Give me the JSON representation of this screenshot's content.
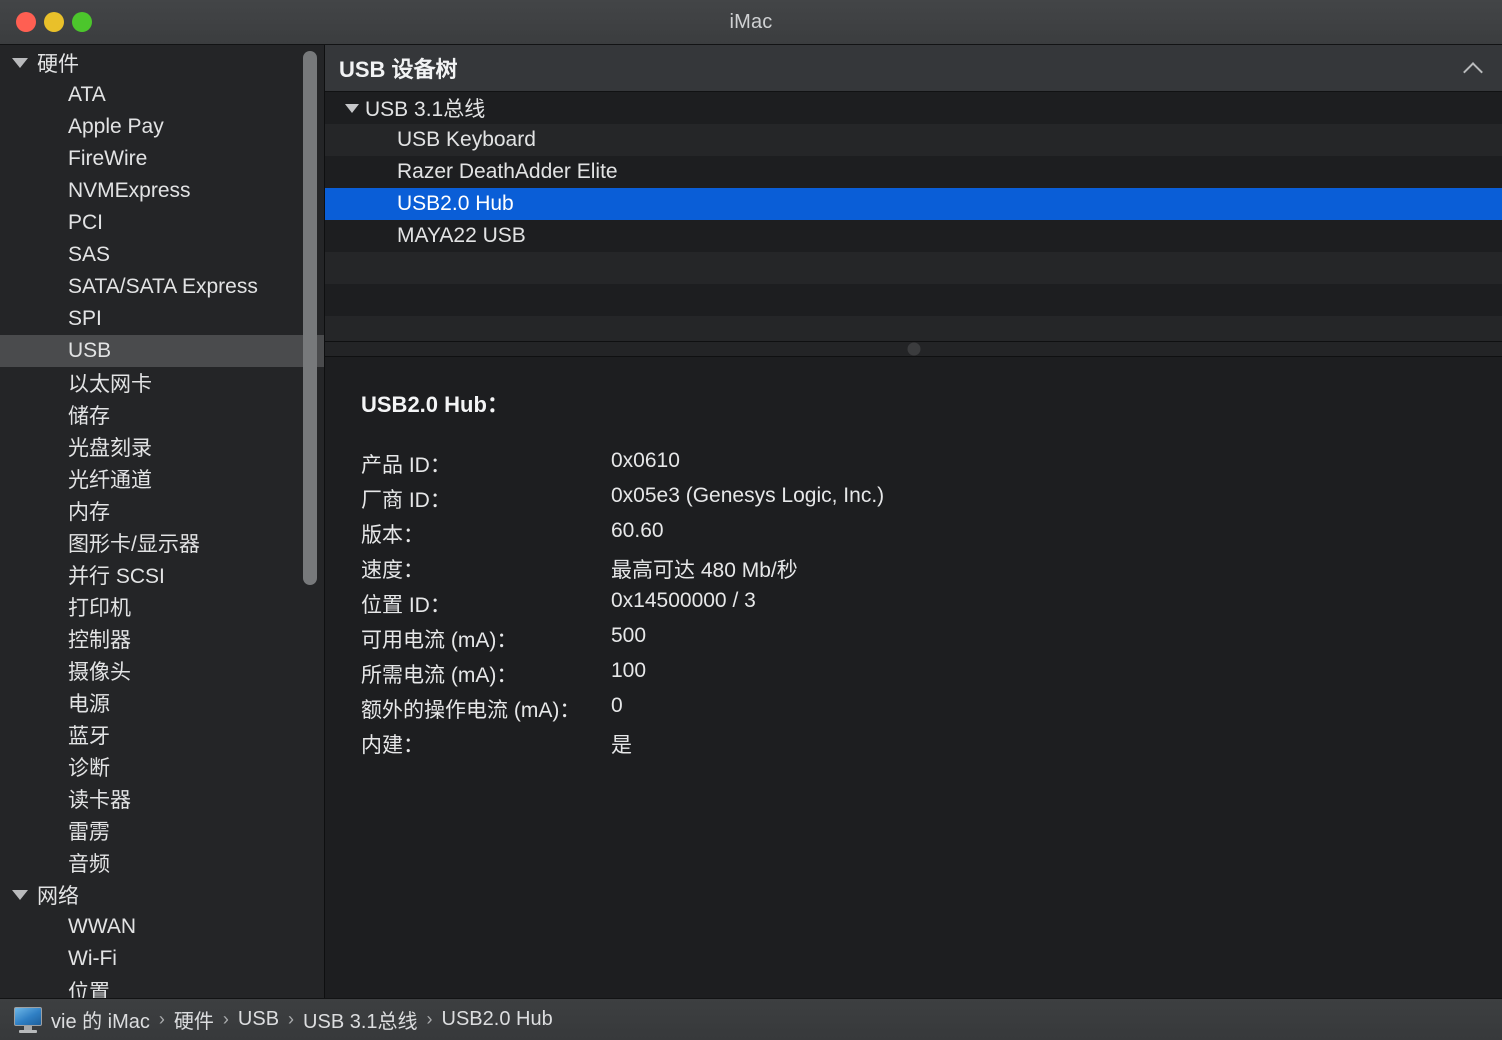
{
  "window": {
    "title": "iMac",
    "traffic_lights": [
      {
        "name": "close",
        "color": "#ff5f52"
      },
      {
        "name": "minimize",
        "color": "#e9c02a"
      },
      {
        "name": "zoom",
        "color": "#4cc62c"
      }
    ]
  },
  "sidebar": {
    "items": [
      {
        "label": "硬件",
        "type": "group",
        "expanded": true,
        "selected": false
      },
      {
        "label": "ATA",
        "type": "child",
        "selected": false
      },
      {
        "label": "Apple Pay",
        "type": "child",
        "selected": false
      },
      {
        "label": "FireWire",
        "type": "child",
        "selected": false
      },
      {
        "label": "NVMExpress",
        "type": "child",
        "selected": false
      },
      {
        "label": "PCI",
        "type": "child",
        "selected": false
      },
      {
        "label": "SAS",
        "type": "child",
        "selected": false
      },
      {
        "label": "SATA/SATA Express",
        "type": "child",
        "selected": false
      },
      {
        "label": "SPI",
        "type": "child",
        "selected": false
      },
      {
        "label": "USB",
        "type": "child",
        "selected": true
      },
      {
        "label": "以太网卡",
        "type": "child",
        "selected": false
      },
      {
        "label": "储存",
        "type": "child",
        "selected": false
      },
      {
        "label": "光盘刻录",
        "type": "child",
        "selected": false
      },
      {
        "label": "光纤通道",
        "type": "child",
        "selected": false
      },
      {
        "label": "内存",
        "type": "child",
        "selected": false
      },
      {
        "label": "图形卡/显示器",
        "type": "child",
        "selected": false
      },
      {
        "label": "并行 SCSI",
        "type": "child",
        "selected": false
      },
      {
        "label": "打印机",
        "type": "child",
        "selected": false
      },
      {
        "label": "控制器",
        "type": "child",
        "selected": false
      },
      {
        "label": "摄像头",
        "type": "child",
        "selected": false
      },
      {
        "label": "电源",
        "type": "child",
        "selected": false
      },
      {
        "label": "蓝牙",
        "type": "child",
        "selected": false
      },
      {
        "label": "诊断",
        "type": "child",
        "selected": false
      },
      {
        "label": "读卡器",
        "type": "child",
        "selected": false
      },
      {
        "label": "雷雳",
        "type": "child",
        "selected": false
      },
      {
        "label": "音频",
        "type": "child",
        "selected": false
      },
      {
        "label": "网络",
        "type": "group",
        "expanded": true,
        "selected": false
      },
      {
        "label": "WWAN",
        "type": "child",
        "selected": false
      },
      {
        "label": "Wi-Fi",
        "type": "child",
        "selected": false
      },
      {
        "label": "位置",
        "type": "child",
        "selected": false
      }
    ]
  },
  "pane": {
    "header_title": "USB 设备树",
    "collapse_icon": "chevron-up-icon"
  },
  "tree": {
    "rows": [
      {
        "label": "USB 3.1总线",
        "type": "bus",
        "expanded": true,
        "selected": false
      },
      {
        "label": "USB Keyboard",
        "type": "dev",
        "selected": false
      },
      {
        "label": "Razer DeathAdder Elite",
        "type": "dev",
        "selected": false
      },
      {
        "label": "USB2.0 Hub",
        "type": "dev",
        "selected": true
      },
      {
        "label": "MAYA22 USB",
        "type": "dev",
        "selected": false
      },
      {
        "label": "",
        "type": "empty",
        "selected": false
      },
      {
        "label": "",
        "type": "empty",
        "selected": false
      },
      {
        "label": "",
        "type": "empty",
        "selected": false
      }
    ],
    "selection_color": "#0a5ed7"
  },
  "detail": {
    "title": "USB2.0 Hub：",
    "rows": [
      {
        "label": "产品 ID：",
        "value": "0x0610"
      },
      {
        "label": "厂商 ID：",
        "value": "0x05e3  (Genesys Logic, Inc.)"
      },
      {
        "label": "版本：",
        "value": "60.60"
      },
      {
        "label": "速度：",
        "value": "最高可达 480 Mb/秒"
      },
      {
        "label": "位置 ID：",
        "value": "0x14500000 / 3"
      },
      {
        "label": "可用电流 (mA)：",
        "value": "500"
      },
      {
        "label": "所需电流 (mA)：",
        "value": "100"
      },
      {
        "label": "额外的操作电流 (mA)：",
        "value": "0"
      },
      {
        "label": "内建：",
        "value": "是"
      }
    ]
  },
  "statusbar": {
    "icon": "imac-icon",
    "separator": "›",
    "crumbs": [
      "vie 的 iMac",
      "硬件",
      "USB",
      "USB 3.1总线",
      "USB2.0 Hub"
    ]
  }
}
